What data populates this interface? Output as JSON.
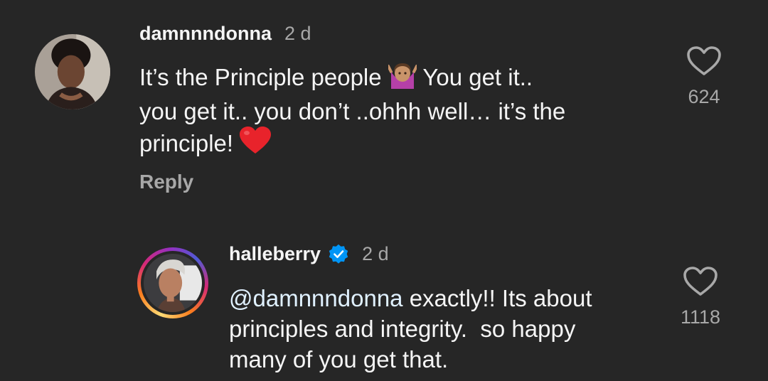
{
  "comments": [
    {
      "username": "damnnndonna",
      "time": "2 d",
      "text_line1a": "It’s the Principle people",
      "text_line1b": "You get it..",
      "text_line2": "you get it.. you don’t ..ohhh well… it’s the",
      "text_line3": "principle!",
      "emoji_1": "person-shrugging-emoji",
      "emoji_2": "red-heart-emoji",
      "reply_label": "Reply",
      "like_count": "624"
    },
    {
      "username": "halleberry",
      "verified": true,
      "time": "2 d",
      "mention": "@damnnndonna",
      "text_line1": "exactly!! Its about",
      "text_line2": "principles and integrity.  so happy",
      "text_line3": "many of you get that.",
      "like_count": "1118"
    }
  ],
  "colors": {
    "background": "#262626",
    "primary_text": "#f5f5f5",
    "secondary_text": "#a8a8a8",
    "verified_blue": "#0095f6"
  }
}
